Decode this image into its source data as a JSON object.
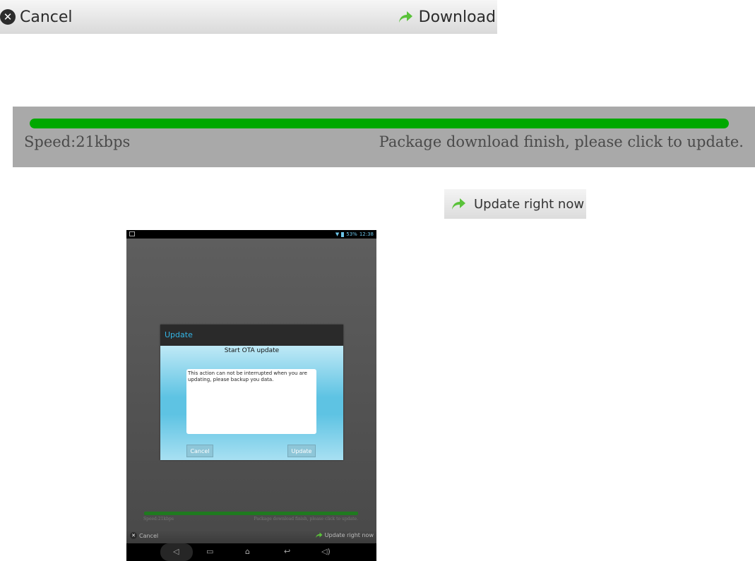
{
  "top_bar": {
    "cancel_label": "Cancel",
    "download_label": "Download",
    "cancel_icon": "close-circle-icon",
    "download_icon": "green-forward-arrow-icon"
  },
  "progress_panel": {
    "progress": 1.0,
    "speed_text": "Speed:21kbps",
    "status_text": "Package download finish, please click to update."
  },
  "update_now_button": {
    "label": "Update right now",
    "icon": "green-forward-arrow-icon"
  },
  "tablet": {
    "status_bar": {
      "battery": "53%",
      "time": "12:38"
    },
    "dialog": {
      "title": "Update",
      "subtitle": "Start OTA update",
      "message": "This action can not be interrupted when you are updating, please backup you data.",
      "cancel_label": "Cancel",
      "update_label": "Update"
    },
    "progress": 1.0,
    "speed_text": "Speed:21kbps",
    "status_text": "Package download finish, please click to update.",
    "cancel_label": "Cancel",
    "update_now_label": "Update right now"
  },
  "colors": {
    "accent_green": "#00a800",
    "dialog_title": "#33b5e5",
    "dialog_body": "#6ec8e6"
  }
}
